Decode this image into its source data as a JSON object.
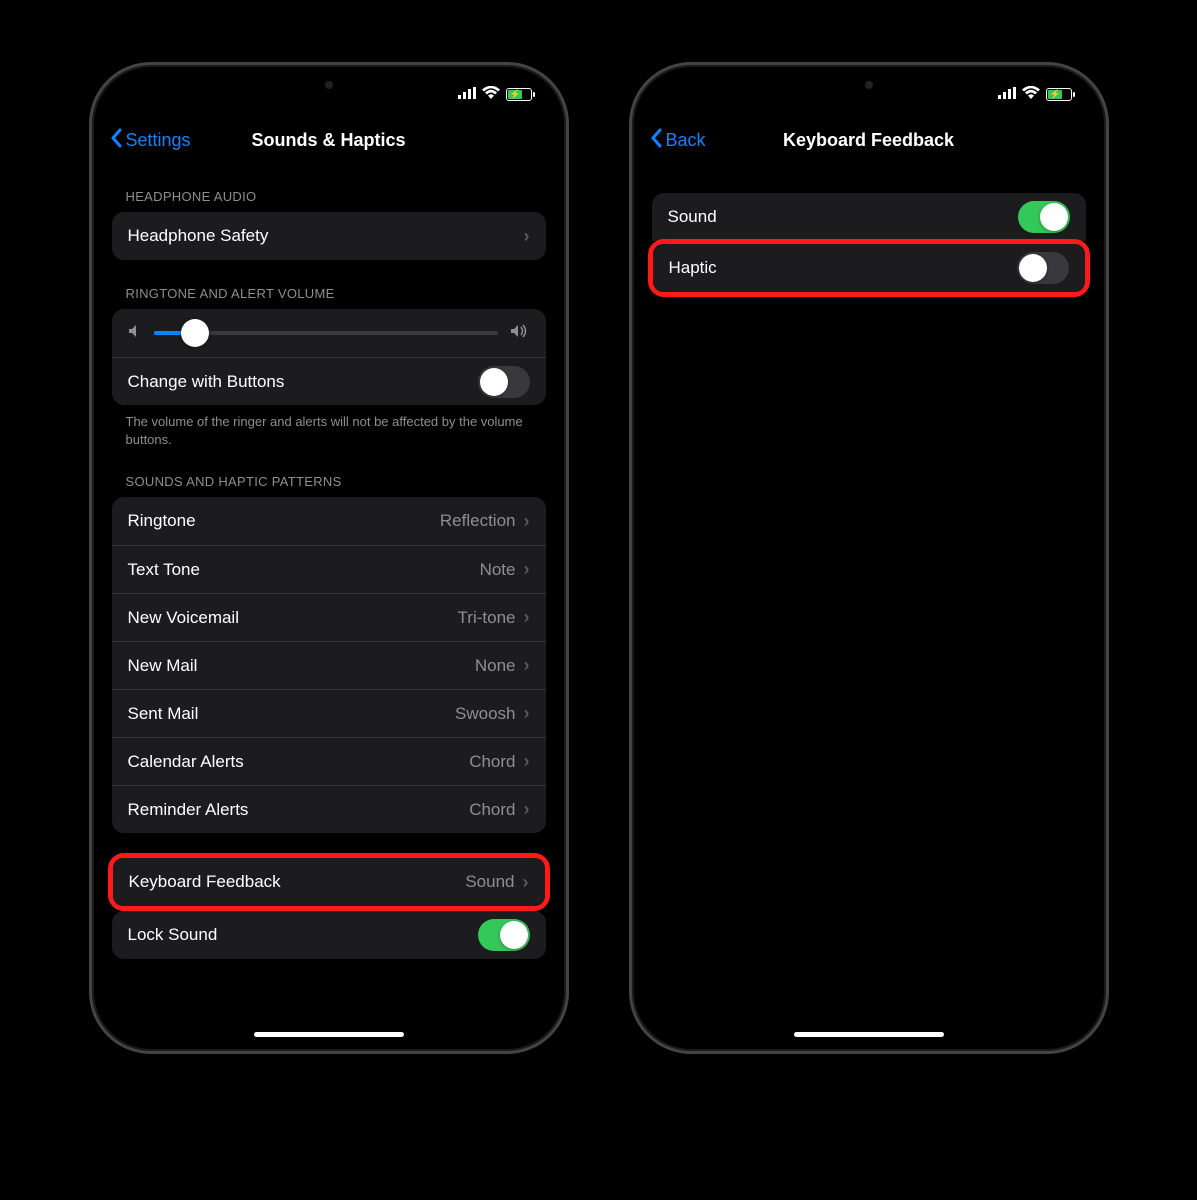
{
  "left": {
    "back": "Settings",
    "title": "Sounds & Haptics",
    "headphone_header": "HEADPHONE AUDIO",
    "headphone_safety": "Headphone Safety",
    "ringtone_header": "RINGTONE AND ALERT VOLUME",
    "change_buttons": "Change with Buttons",
    "change_buttons_on": false,
    "volume_footer": "The volume of the ringer and alerts will not be affected by the volume buttons.",
    "patterns_header": "SOUNDS AND HAPTIC PATTERNS",
    "patterns": [
      {
        "label": "Ringtone",
        "value": "Reflection"
      },
      {
        "label": "Text Tone",
        "value": "Note"
      },
      {
        "label": "New Voicemail",
        "value": "Tri-tone"
      },
      {
        "label": "New Mail",
        "value": "None"
      },
      {
        "label": "Sent Mail",
        "value": "Swoosh"
      },
      {
        "label": "Calendar Alerts",
        "value": "Chord"
      },
      {
        "label": "Reminder Alerts",
        "value": "Chord"
      }
    ],
    "keyboard_feedback_label": "Keyboard Feedback",
    "keyboard_feedback_value": "Sound",
    "lock_sound_label": "Lock Sound",
    "lock_sound_on": true,
    "volume_percent": 12
  },
  "right": {
    "back": "Back",
    "title": "Keyboard Feedback",
    "sound_label": "Sound",
    "sound_on": true,
    "haptic_label": "Haptic",
    "haptic_on": false
  }
}
